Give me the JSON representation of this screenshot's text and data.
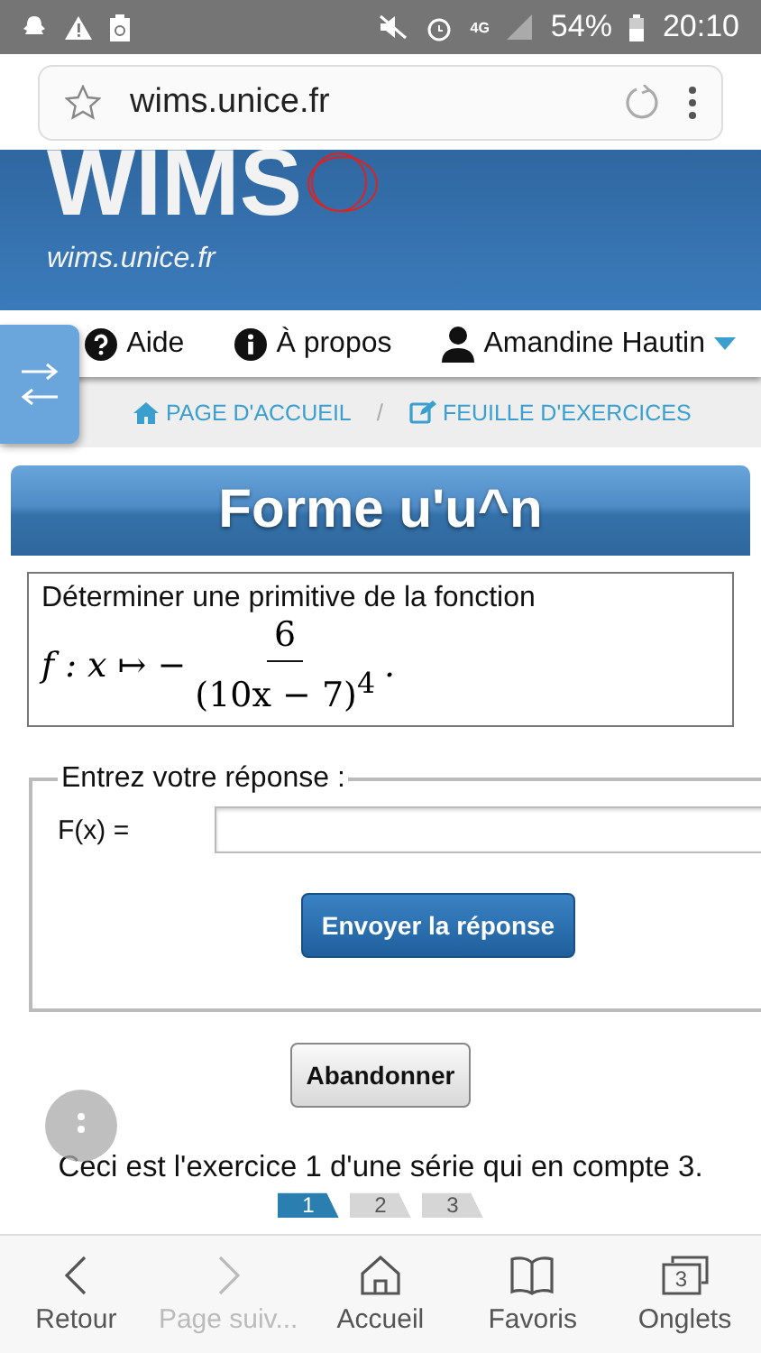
{
  "status_bar": {
    "network": "4G",
    "battery": "54%",
    "time": "20:10"
  },
  "address_bar": {
    "url": "wims.unice.fr"
  },
  "banner": {
    "logo": "WIMS",
    "subtitle": "wims.unice.fr"
  },
  "nav": {
    "items": [
      {
        "kind": "help",
        "label": "Aide"
      },
      {
        "kind": "info",
        "label": "À propos"
      },
      {
        "kind": "user",
        "label": "Amandine Hautin"
      }
    ]
  },
  "breadcrumb_separator": "/",
  "breadcrumb": [
    {
      "kind": "home",
      "label": "PAGE D'ACCUEIL"
    },
    {
      "kind": "edit",
      "label": "FEUILLE D'EXERCICES"
    }
  ],
  "exercise": {
    "title": "Forme u'u^n",
    "prompt": "Déterminer une primitive de la fonction",
    "lhs": "f : x ↦ −",
    "numerator": "6",
    "denominator": "(10x − 7)$^{4}$",
    "end": "."
  },
  "answer": {
    "legend": "Entrez votre réponse :",
    "label": "F(x) =",
    "submit": "Envoyer la réponse"
  },
  "abandon": "Abandonner",
  "series_note": "Ceci est l'exercice 1 d'une série qui en compte 3.",
  "steps": [
    {
      "label": "1",
      "selected": true
    },
    {
      "label": "2",
      "selected": false
    },
    {
      "label": "3",
      "selected": false
    }
  ],
  "bottom_bar": [
    {
      "kind": "back",
      "label": "Retour",
      "disabled": false
    },
    {
      "kind": "forward",
      "label": "Page suiv...",
      "disabled": true
    },
    {
      "kind": "home",
      "label": "Accueil",
      "disabled": false
    },
    {
      "kind": "bookmarks",
      "label": "Favoris",
      "disabled": false
    },
    {
      "kind": "tabs",
      "label": "Onglets",
      "badge": "3",
      "disabled": false
    }
  ]
}
